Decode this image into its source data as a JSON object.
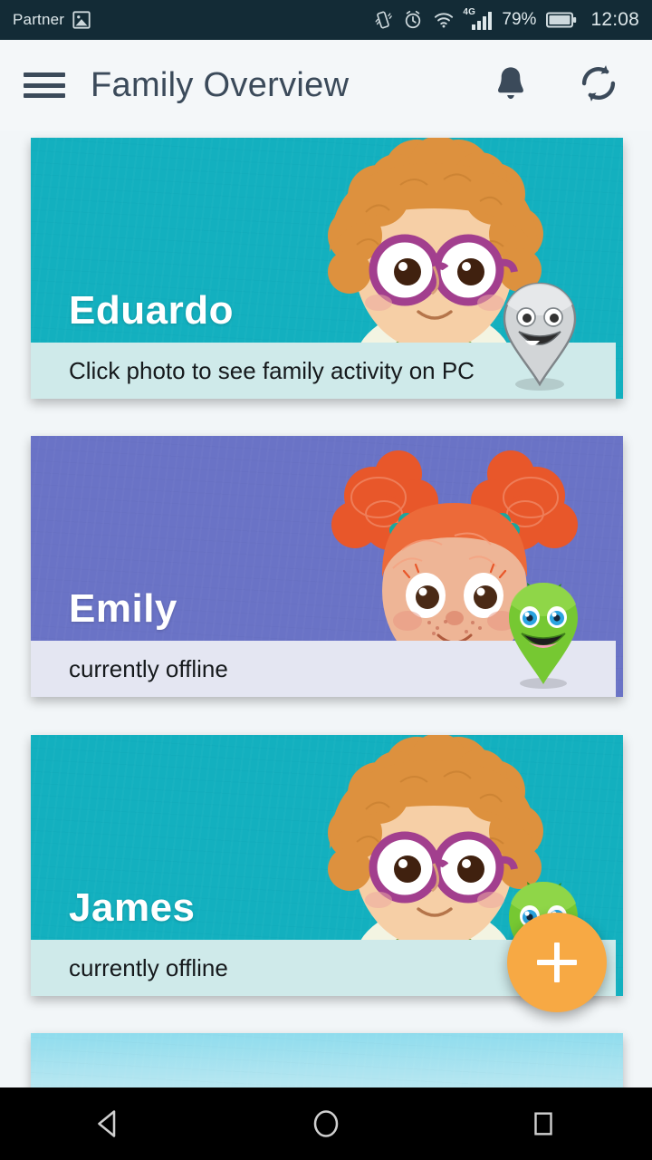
{
  "statusbar": {
    "carrier": "Partner",
    "carrier_icon": "image-icon",
    "icons": [
      "vibrate-icon",
      "alarm-icon",
      "wifi-icon"
    ],
    "network_type": "4G",
    "battery_percent": "79%",
    "time": "12:08",
    "background": "#132b36",
    "foreground": "#dde7ea"
  },
  "appbar": {
    "menu_icon": "hamburger-menu-icon",
    "title": "Family Overview",
    "notifications_icon": "bell-icon",
    "refresh_icon": "refresh-icon",
    "background": "#f4f7f9",
    "text_color": "#3b4a5a"
  },
  "cards": [
    {
      "name": "Eduardo",
      "status": "Click photo to see family activity on PC",
      "bg_color": "#13b0bf",
      "footer_color": "#cfeaea",
      "avatar": "boy-curly-hair-glasses",
      "pin": "grey-smiling-pin-character",
      "pin_color": "#c9ccce"
    },
    {
      "name": "Emily",
      "status": "currently offline",
      "bg_color": "#6a73c6",
      "footer_color": "#e4e6f2",
      "avatar": "girl-red-pigtails",
      "pin": "green-monster-pin-character",
      "pin_color": "#76c832"
    },
    {
      "name": "James",
      "status": "currently offline",
      "bg_color": "#13b0bf",
      "footer_color": "#cfeaea",
      "avatar": "boy-curly-hair-glasses",
      "pin": "green-monster-pin-character",
      "pin_color": "#76c832"
    },
    {
      "name": "",
      "status": "",
      "bg_color": "#8fdced",
      "footer_color": "#cfeaea",
      "avatar": "",
      "pin": "",
      "pin_color": ""
    }
  ],
  "fab": {
    "icon": "plus-icon",
    "label": "+",
    "color": "#f7a944"
  },
  "navbar": {
    "back_icon": "back-triangle-icon",
    "home_icon": "home-circle-icon",
    "recents_icon": "recents-square-icon",
    "background": "#000000"
  }
}
